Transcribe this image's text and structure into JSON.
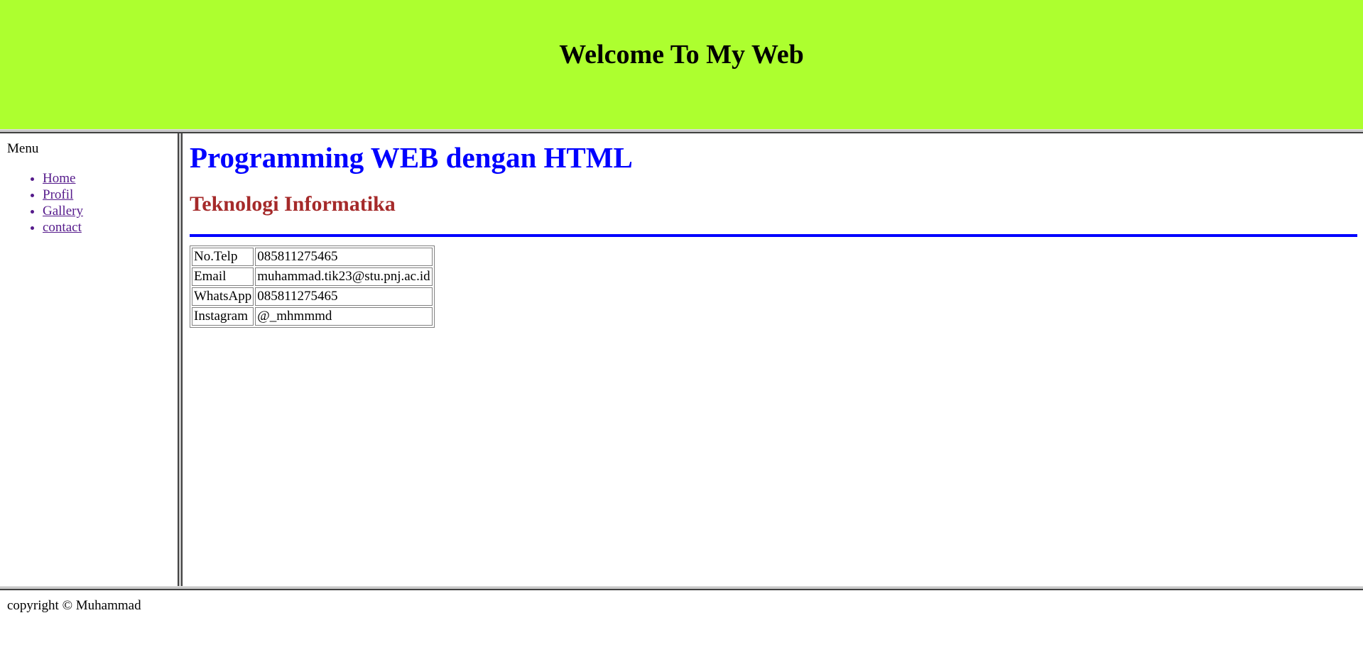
{
  "header": {
    "title": "Welcome To My Web",
    "background": "#adff2f"
  },
  "menu": {
    "title": "Menu",
    "items": [
      {
        "label": "Home"
      },
      {
        "label": "Profil"
      },
      {
        "label": "Gallery"
      },
      {
        "label": "contact"
      }
    ],
    "link_color": "#551a8b"
  },
  "main": {
    "heading": "Programming WEB dengan HTML",
    "heading_color": "#0000ff",
    "subheading": "Teknologi Informatika",
    "subheading_color": "#a52a2a",
    "rule_color": "#0000ff",
    "contacts": [
      {
        "label": "No.Telp",
        "value": "085811275465"
      },
      {
        "label": "Email",
        "value": "muhammad.tik23@stu.pnj.ac.id"
      },
      {
        "label": "WhatsApp",
        "value": "085811275465"
      },
      {
        "label": "Instagram",
        "value": "@_mhmmmd"
      }
    ]
  },
  "footer": {
    "text": "copyright © Muhammad"
  }
}
